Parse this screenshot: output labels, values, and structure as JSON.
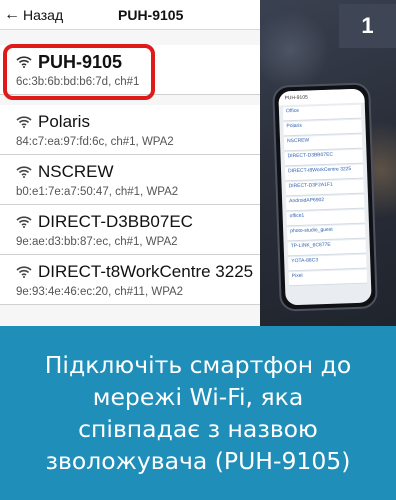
{
  "wifi_screen": {
    "back_label": "Назад",
    "title": "PUH-9105",
    "networks": [
      {
        "name": "PUH-9105",
        "details": "6c:3b:6b:bd:b6:7d, ch#1"
      },
      {
        "name": "Polaris",
        "details": "84:c7:ea:97:fd:6c, ch#1, WPA2"
      },
      {
        "name": "NSCREW",
        "details": "b0:e1:7e:a7:50:47, ch#1, WPA2"
      },
      {
        "name": "DIRECT-D3BB07EC",
        "details": "9e:ae:d3:bb:87:ec, ch#1, WPA2"
      },
      {
        "name": "DIRECT-t8WorkCentre 3225",
        "details": "9e:93:4e:46:ec:20, ch#11, WPA2"
      }
    ],
    "highlight_color": "#e01919"
  },
  "photo": {
    "phone_screen": {
      "header": "PUH-9105",
      "rows": [
        "Office",
        "Polaris",
        "NSCREW",
        "DIRECT-D3BB07EC",
        "DIRECT-t8WorkCentre 3225",
        "DIRECT-D3F2A1F1",
        "AndroidAP6902",
        "office1",
        "photo-studio_guest",
        "TP-LINK_6C877E",
        "YOTA-88C3",
        "Pixel"
      ]
    }
  },
  "step_badge": "1",
  "caption": {
    "lines": [
      "Підключіть смартфон до",
      "мережі Wi-Fi, яка",
      "співпадає з назвою",
      "зволожувача (PUH-9105)"
    ],
    "background": "#1f8fb9"
  }
}
